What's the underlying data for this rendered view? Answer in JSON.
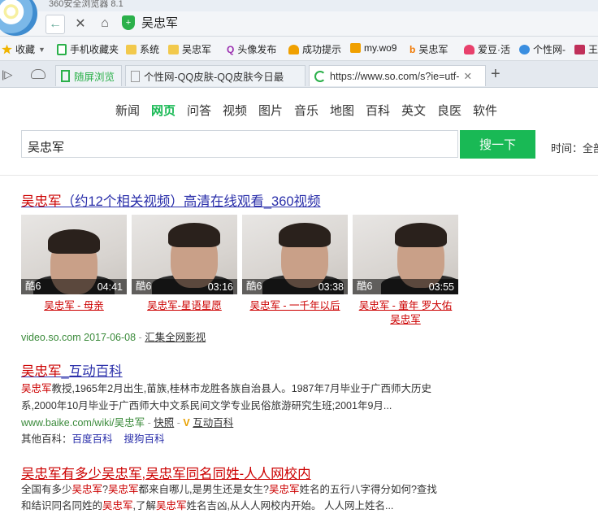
{
  "browser": {
    "title": "360安全浏览器 8.1",
    "address": "吴忠军",
    "bookmarks": [
      {
        "label": "收藏",
        "color": "#f0b400"
      },
      {
        "label": "手机收藏夹",
        "color": "#2bb04a"
      },
      {
        "label": "系统",
        "color": "#f2c94c"
      },
      {
        "label": "吴忠军",
        "color": "#f2c94c"
      },
      {
        "label": "头像发布",
        "color": "#9b2fb0"
      },
      {
        "label": "成功提示",
        "color": "#f0a000"
      },
      {
        "label": "my.wo9",
        "color": "#f0a000"
      },
      {
        "label": "吴忠军",
        "color": "#f07800"
      },
      {
        "label": "爱豆·活",
        "color": "#e8406c"
      },
      {
        "label": "个性网-",
        "color": "#3a8ee0"
      },
      {
        "label": "王",
        "color": "#c0305a"
      }
    ],
    "tabs": [
      {
        "label": "随屏浏览",
        "active": false
      },
      {
        "label": "个性网-QQ皮肤-QQ皮肤今日最",
        "active": false
      },
      {
        "label": "https://www.so.com/s?ie=utf-",
        "active": true
      }
    ]
  },
  "search": {
    "nav": [
      "新闻",
      "网页",
      "问答",
      "视频",
      "图片",
      "音乐",
      "地图",
      "百科",
      "英文",
      "良医",
      "软件"
    ],
    "active_nav": "网页",
    "query": "吴忠军",
    "button": "搜一下",
    "time_filter": "时间：全部"
  },
  "results": {
    "video_result": {
      "title_pre": "吴忠军",
      "title_rest": "（约12个相关视频）高清在线观看_360视频",
      "videos": [
        {
          "source": "酷6",
          "duration": "04:41",
          "caption": "吴忠军 - 母亲"
        },
        {
          "source": "酷6",
          "duration": "03:16",
          "caption": "吴忠军-星语星愿"
        },
        {
          "source": "酷6",
          "duration": "03:38",
          "caption": "吴忠军 - 一千年以后"
        },
        {
          "source": "酷6",
          "duration": "03:55",
          "caption": "吴忠军 - 童年 罗大佑 吴忠军"
        }
      ],
      "meta_green": "video.so.com 2017-06-08",
      "meta_sep": "-",
      "meta_link": "汇集全网影视"
    },
    "baike_result": {
      "title_pre": "吴忠军",
      "title_rest": "_互动百科",
      "line1_hl": "吴忠军",
      "line1": "教授,1965年2月出生,苗族,桂林市龙胜各族自治县人。1987年7月毕业于广西师大历史",
      "line2": "系,2000年10月毕业于广西师大中文系民间文学专业民俗旅游研究生班;2001年9月...",
      "url": "www.baike.com/wiki/吴忠军",
      "snapshot": "快照",
      "source": "互动百科",
      "other_label": "其他百科：",
      "other_links": [
        "百度百科",
        "搜狗百科"
      ]
    },
    "renren_result": {
      "title": "吴忠军有多少吴忠军,吴忠军同名同姓-人人网校内",
      "line1": "全国有多少吴忠军?吴忠军都来自哪儿,是男生还是女生?吴忠军姓名的五行八字得分如何?查找",
      "line2": "和结识同名同姓的吴忠军,了解吴忠军姓名吉凶,从人人网校内开始。 人人网上姓名..."
    }
  }
}
